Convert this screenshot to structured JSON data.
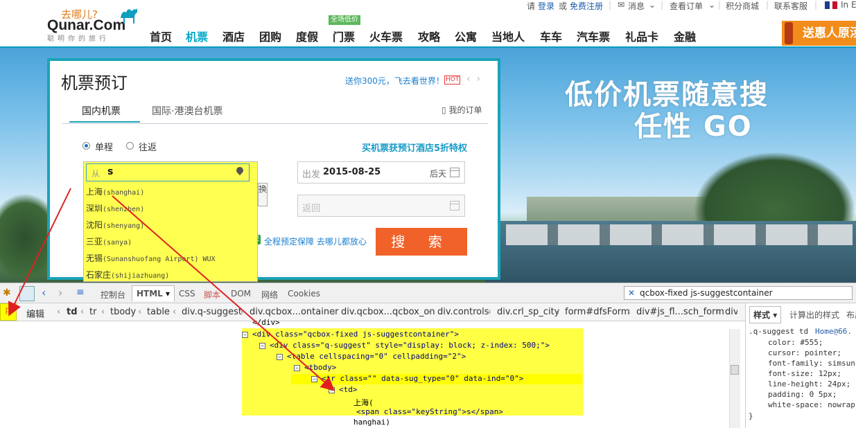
{
  "topbar": {
    "please": "请",
    "login": "登录",
    "or": "或",
    "register": "免费注册",
    "messages": "消息",
    "check_order": "查看订单",
    "points_mall": "积分商城",
    "contact_service": "联系客服",
    "lang": "In E"
  },
  "logo": {
    "cn": "去哪儿?",
    "en": "Qunar.Com",
    "sub": "聪明你的旅行"
  },
  "nav": {
    "badge": "全场低价",
    "items": [
      "首页",
      "机票",
      "酒店",
      "团购",
      "度假",
      "门票",
      "火车票",
      "攻略",
      "公寓",
      "当地人",
      "车车",
      "汽车票",
      "礼品卡",
      "金融"
    ],
    "active_index": 1
  },
  "promo_right": "送惠人原汤",
  "banner": {
    "slogan1": "低价机票随意搜",
    "slogan2": "任性 GO"
  },
  "booking": {
    "title": "机票预订",
    "promo": "送你300元，飞去看世界！",
    "hot": "HOT",
    "tabs": [
      "国内机票",
      "国际·港澳台机票"
    ],
    "my_orders": "我的订单",
    "trip_types": [
      "单程",
      "往返"
    ],
    "selected_trip": "单程",
    "hotel_promo": "买机票获预订酒店5折特权",
    "from_label": "从",
    "from_value": "s",
    "swap_label": "换",
    "depart_label": "出发",
    "depart_date": "2015-08-25",
    "depart_day": "后天",
    "return_placeholder": "返回",
    "guarantee_icon": "保",
    "guarantee": "全程预定保障 去哪儿都放心",
    "search_button": "搜 索"
  },
  "suggestions": [
    {
      "city": "上海",
      "pinyin": "(shanghai)"
    },
    {
      "city": "深圳",
      "pinyin": "(shenzhen)"
    },
    {
      "city": "沈阳",
      "pinyin": "(shenyang)"
    },
    {
      "city": "三亚",
      "pinyin": "(sanya)"
    },
    {
      "city": "无锡",
      "pinyin": "(Sunanshuofang Airport) WUX"
    },
    {
      "city": "石家庄",
      "pinyin": "(shijiazhuang)"
    }
  ],
  "devtools": {
    "tabs": [
      "控制台",
      "HTML",
      "CSS",
      "脚本",
      "DOM",
      "网络",
      "Cookies"
    ],
    "search_value": "qcbox-fixed js-suggestcontainer",
    "edit": "编辑",
    "breadcrumbs": [
      "td",
      "tr",
      "tbody",
      "table",
      "div.q-suggest",
      "div.qcbox...ontainer",
      "div.qcbox...qcbox_on",
      "div.controls",
      "div.crl_sp_city",
      "form#dfsForm",
      "div#js_fl...sch_form",
      "div"
    ],
    "right_tabs": [
      "样式",
      "计算出的样式",
      "布局"
    ],
    "code": [
      "</div>",
      "<div class=\"qcbox-fixed js-suggestcontainer\">",
      "<div class=\"q-suggest\" style=\"display: block; z-index: 500;\">",
      "<table cellspacing=\"0\" cellpadding=\"2\">",
      "<tbody>",
      "<tr class=\"\" data-sug_type=\"0\" data-ind=\"0\">",
      "<td>",
      "上海(",
      "<span class=\"keyString\">s</span>",
      "hanghai)"
    ],
    "css_rule": {
      "selector": ".q-suggest td",
      "source": "Home@66.",
      "props": [
        "color: #555;",
        "cursor: pointer;",
        "font-family: simsun",
        "font-size: 12px;",
        "line-height: 24px;",
        "padding: 0 5px;",
        "white-space: nowrap"
      ],
      "close": "}"
    }
  },
  "colors": {
    "accent": "#1aa3b8",
    "search_button": "#f06229",
    "highlight": "#ffff44",
    "annotation_arrow": "#e02020"
  }
}
